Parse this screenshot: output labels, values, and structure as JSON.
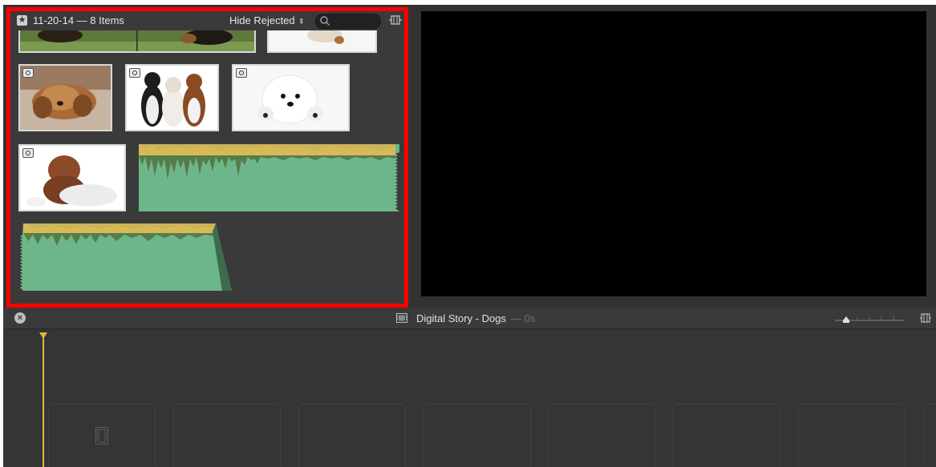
{
  "browser": {
    "event_title": "11-20-14 — 8 Items",
    "filter_label": "Hide Rejected",
    "search": {
      "value": "",
      "placeholder": ""
    },
    "clips": [
      {
        "kind": "video",
        "subject": "dogs on grass (top, partially scrolled)"
      },
      {
        "kind": "photo",
        "subject": "white dog (top, partially scrolled)"
      },
      {
        "kind": "photo",
        "subject": "sleeping puppy"
      },
      {
        "kind": "photo",
        "subject": "three dogs sitting"
      },
      {
        "kind": "photo",
        "subject": "white puppy"
      },
      {
        "kind": "photo",
        "subject": "wrinkled puppy"
      },
      {
        "kind": "audio",
        "subject": "audio clip"
      },
      {
        "kind": "audio",
        "subject": "audio clip"
      }
    ]
  },
  "timeline": {
    "project_title": "Digital Story - Dogs",
    "project_duration": "— 0s"
  },
  "colors": {
    "highlight_border": "#ff0000",
    "audio_fill": "#6db68a",
    "audio_peak": "#d8b957",
    "playhead": "#e3b73a"
  }
}
